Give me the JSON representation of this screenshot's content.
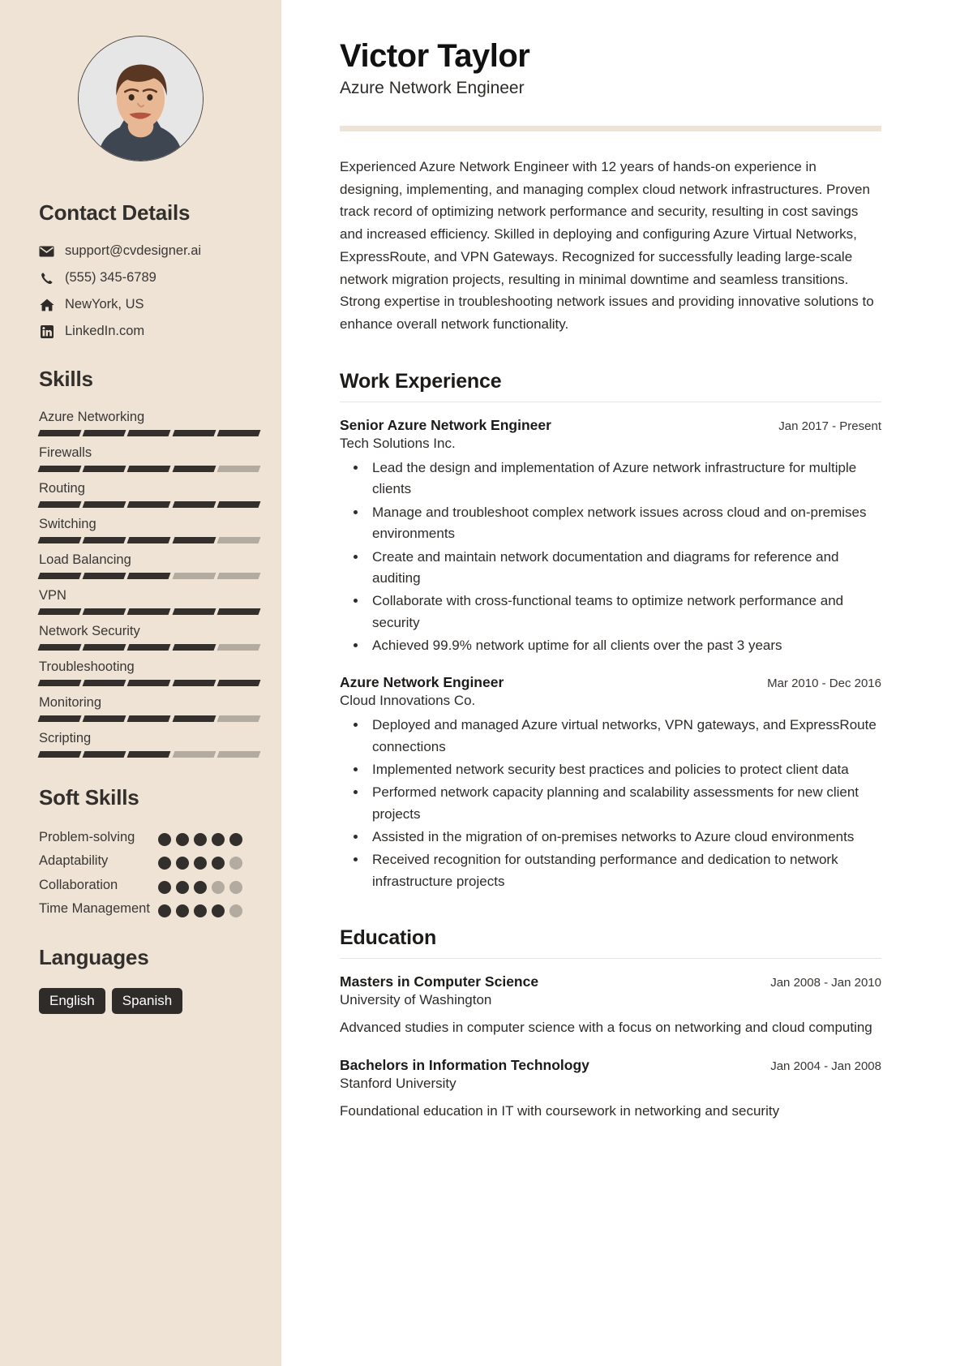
{
  "theme": {
    "sidebar_bg": "#efe3d5",
    "accent": "#efe3d5",
    "ink": "#2e2b28",
    "muted": "#b3aaa0"
  },
  "header": {
    "name": "Victor Taylor",
    "role": "Azure Network Engineer"
  },
  "summary": "Experienced Azure Network Engineer with 12 years of hands-on experience in designing, implementing, and managing complex cloud network infrastructures. Proven track record of optimizing network performance and security, resulting in cost savings and increased efficiency. Skilled in deploying and configuring Azure Virtual Networks, ExpressRoute, and VPN Gateways. Recognized for successfully leading large-scale network migration projects, resulting in minimal downtime and seamless transitions. Strong expertise in troubleshooting network issues and providing innovative solutions to enhance overall network functionality.",
  "sidebar": {
    "avatar_alt": "profile-photo",
    "contact": {
      "heading": "Contact Details",
      "items": [
        {
          "icon": "envelope-icon",
          "value": "support@cvdesigner.ai"
        },
        {
          "icon": "phone-icon",
          "value": "(555) 345-6789"
        },
        {
          "icon": "home-icon",
          "value": "NewYork, US"
        },
        {
          "icon": "linkedin-icon",
          "value": "LinkedIn.com"
        }
      ]
    },
    "skills": {
      "heading": "Skills",
      "max": 5,
      "items": [
        {
          "label": "Azure Networking",
          "level": 5
        },
        {
          "label": "Firewalls",
          "level": 4
        },
        {
          "label": "Routing",
          "level": 5
        },
        {
          "label": "Switching",
          "level": 4
        },
        {
          "label": "Load Balancing",
          "level": 3
        },
        {
          "label": "VPN",
          "level": 5
        },
        {
          "label": "Network Security",
          "level": 4
        },
        {
          "label": "Troubleshooting",
          "level": 5
        },
        {
          "label": "Monitoring",
          "level": 4
        },
        {
          "label": "Scripting",
          "level": 3
        }
      ]
    },
    "soft_skills": {
      "heading": "Soft Skills",
      "max": 5,
      "items": [
        {
          "label": "Problem-solving",
          "level": 5
        },
        {
          "label": "Adaptability",
          "level": 4
        },
        {
          "label": "Collaboration",
          "level": 3
        },
        {
          "label": "Time Management",
          "level": 4
        }
      ]
    },
    "languages": {
      "heading": "Languages",
      "items": [
        "English",
        "Spanish"
      ]
    }
  },
  "work": {
    "heading": "Work Experience",
    "entries": [
      {
        "title": "Senior Azure Network Engineer",
        "company": "Tech Solutions Inc.",
        "date": "Jan 2017 - Present",
        "bullets": [
          "Lead the design and implementation of Azure network infrastructure for multiple clients",
          "Manage and troubleshoot complex network issues across cloud and on-premises environments",
          "Create and maintain network documentation and diagrams for reference and auditing",
          "Collaborate with cross-functional teams to optimize network performance and security",
          "Achieved 99.9% network uptime for all clients over the past 3 years"
        ]
      },
      {
        "title": "Azure Network Engineer",
        "company": "Cloud Innovations Co.",
        "date": "Mar 2010 - Dec 2016",
        "bullets": [
          "Deployed and managed Azure virtual networks, VPN gateways, and ExpressRoute connections",
          "Implemented network security best practices and policies to protect client data",
          "Performed network capacity planning and scalability assessments for new client projects",
          "Assisted in the migration of on-premises networks to Azure cloud environments",
          "Received recognition for outstanding performance and dedication to network infrastructure projects"
        ]
      }
    ]
  },
  "education": {
    "heading": "Education",
    "entries": [
      {
        "title": "Masters in Computer Science",
        "school": "University of Washington",
        "date": "Jan 2008 - Jan 2010",
        "description": "Advanced studies in computer science with a focus on networking and cloud computing"
      },
      {
        "title": "Bachelors in Information Technology",
        "school": "Stanford University",
        "date": "Jan 2004 - Jan 2008",
        "description": "Foundational education in IT with coursework in networking and security"
      }
    ]
  }
}
